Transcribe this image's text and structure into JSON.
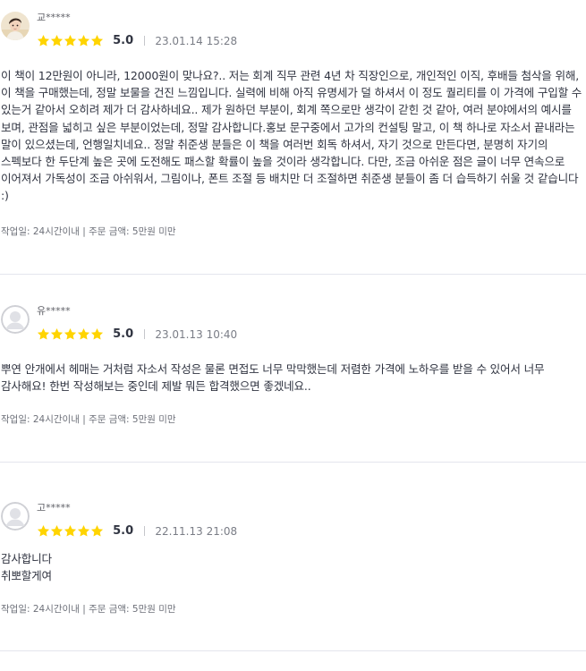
{
  "reviews": [
    {
      "reviewer": "교*****",
      "avatar": "profile-photo",
      "rating": 5,
      "score": "5.0",
      "date": "23.01.14 15:28",
      "content": "이 책이 12만원이 아니라, 12000원이 맞나요?.. 저는 회계 직무 관련 4년 차 직장인으로, 개인적인 이직, 후배들 첨삭을 위해, 이 책을 구매했는데, 정말 보물을 건진 느낌입니다. 실력에 비해 아직 유명세가 덜 하셔서 이 정도 퀄리티를 이 가격에 구입할 수 있는거 같아서 오히려 제가 더 감사하네요.. 제가 원하던 부분이, 회계 쪽으로만 생각이 갇힌 것 같아, 여러 분야에서의 예시를 보며, 관점을 넓히고 싶은 부분이었는데, 정말 감사합니다.홍보 문구중에서 고가의 컨설팅 말고, 이 책 하나로 자소서 끝내라는 말이 있으셨는데, 언행일치네요.. 정말 취준생 분들은 이 책을 여러번 회독 하셔서, 자기 것으로 만든다면, 분명히 자기의 스펙보다 한 두단계 높은 곳에 도전해도 패스할 확률이 높을 것이라 생각합니다.  다만, 조금 아쉬운 점은 글이 너무 연속으로 이어져서 가독성이 조금 아쉬워서, 그림이나, 폰트 조절 등 배치만 더 조절하면 취준생 분들이 좀 더 습득하기 쉬울 것 같습니다 :)",
      "meta": "작업일: 24시간이내 | 주문 금액: 5만원 미만"
    },
    {
      "reviewer": "유*****",
      "avatar": "default-avatar",
      "rating": 5,
      "score": "5.0",
      "date": "23.01.13 10:40",
      "content": "뿌연 안개에서 헤매는 거처럼 자소서 작성은 물론 면접도 너무 막막했는데 저렴한 가격에 노하우를 받을 수 있어서 너무 감사해요! 한번 작성해보는 중인데 제발 뭐든 합격했으면 좋겠네요..",
      "meta": "작업일: 24시간이내 | 주문 금액: 5만원 미만"
    },
    {
      "reviewer": "고*****",
      "avatar": "default-avatar",
      "rating": 5,
      "score": "5.0",
      "date": "22.11.13 21:08",
      "content": "감사합니다\n취뽀할게여",
      "meta": "작업일: 24시간이내 | 주문 금액: 5만원 미만"
    }
  ],
  "colors": {
    "star": "#FFD400",
    "text": "#303441",
    "muted": "#7a7d86",
    "divider": "#e4e5ed"
  }
}
